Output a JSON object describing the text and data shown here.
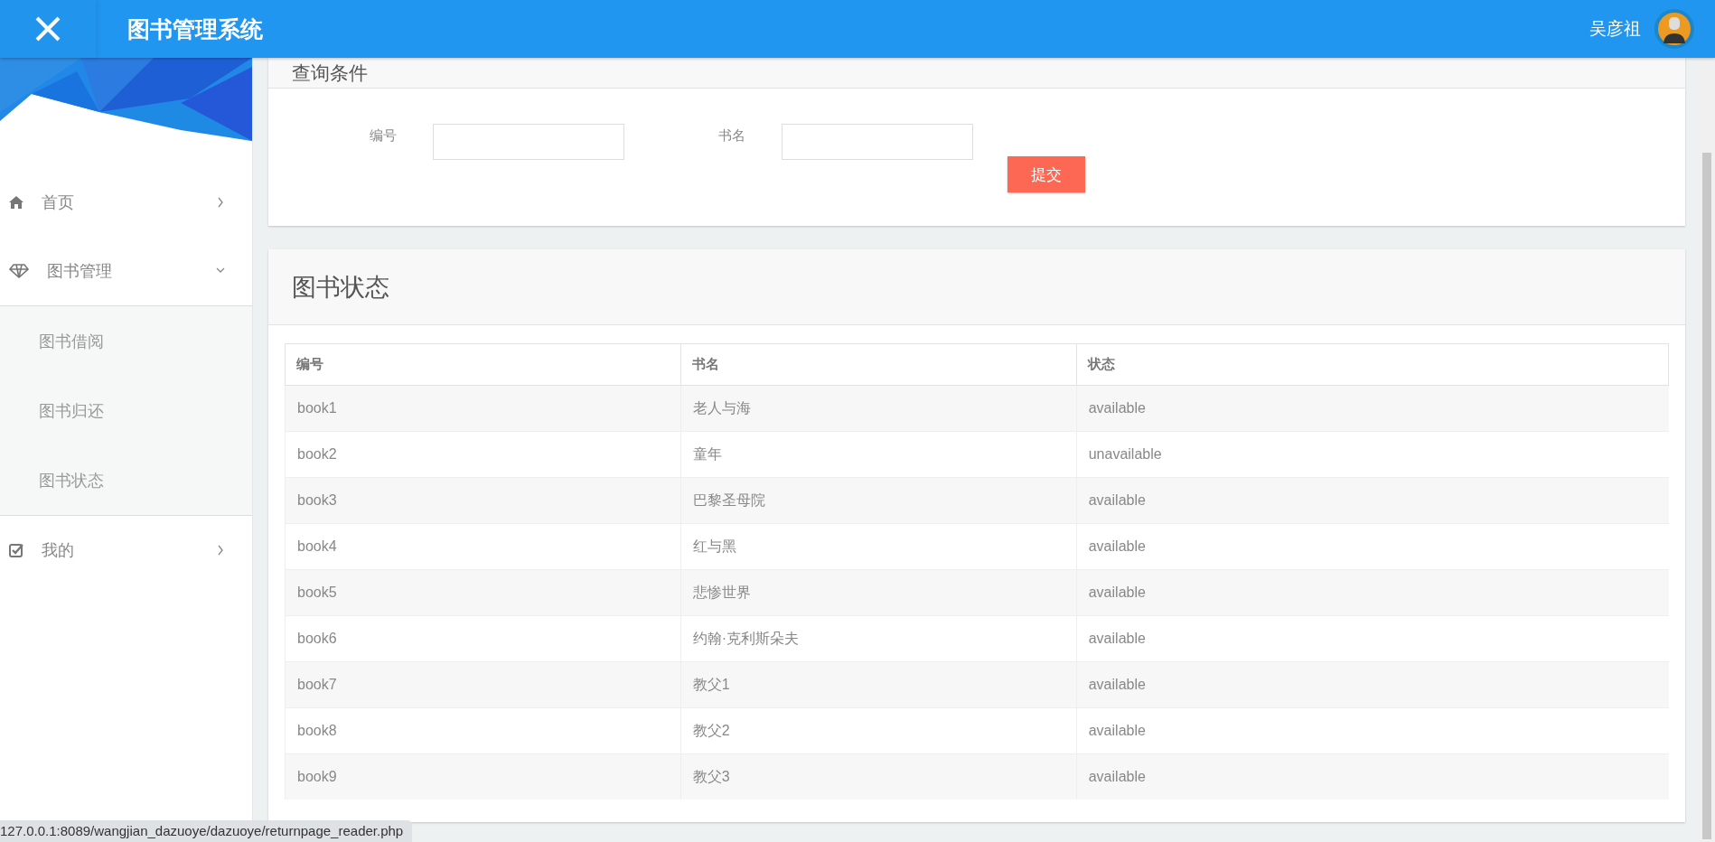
{
  "header": {
    "title": "图书管理系统",
    "user_name": "吴彦祖"
  },
  "sidebar": {
    "items": [
      {
        "label": "首页",
        "expanded": false
      },
      {
        "label": "图书管理",
        "expanded": true,
        "children": [
          {
            "label": "图书借阅"
          },
          {
            "label": "图书归还"
          },
          {
            "label": "图书状态"
          }
        ]
      },
      {
        "label": "我的",
        "expanded": false
      }
    ]
  },
  "query": {
    "title": "查询条件",
    "fields": [
      {
        "label": "编号"
      },
      {
        "label": "书名"
      }
    ],
    "submit": "提交"
  },
  "status": {
    "title": "图书状态",
    "table": {
      "columns": [
        "编号",
        "书名",
        "状态"
      ],
      "rows": [
        [
          "book1",
          "老人与海",
          "available"
        ],
        [
          "book2",
          "童年",
          "unavailable"
        ],
        [
          "book3",
          "巴黎圣母院",
          "available"
        ],
        [
          "book4",
          "红与黑",
          "available"
        ],
        [
          "book5",
          "悲惨世界",
          "available"
        ],
        [
          "book6",
          "约翰·克利斯朵夫",
          "available"
        ],
        [
          "book7",
          "教父1",
          "available"
        ],
        [
          "book8",
          "教父2",
          "available"
        ],
        [
          "book9",
          "教父3",
          "available"
        ]
      ]
    }
  },
  "status_url": "127.0.0.1:8089/wangjian_dazuoye/dazuoye/returnpage_reader.php"
}
